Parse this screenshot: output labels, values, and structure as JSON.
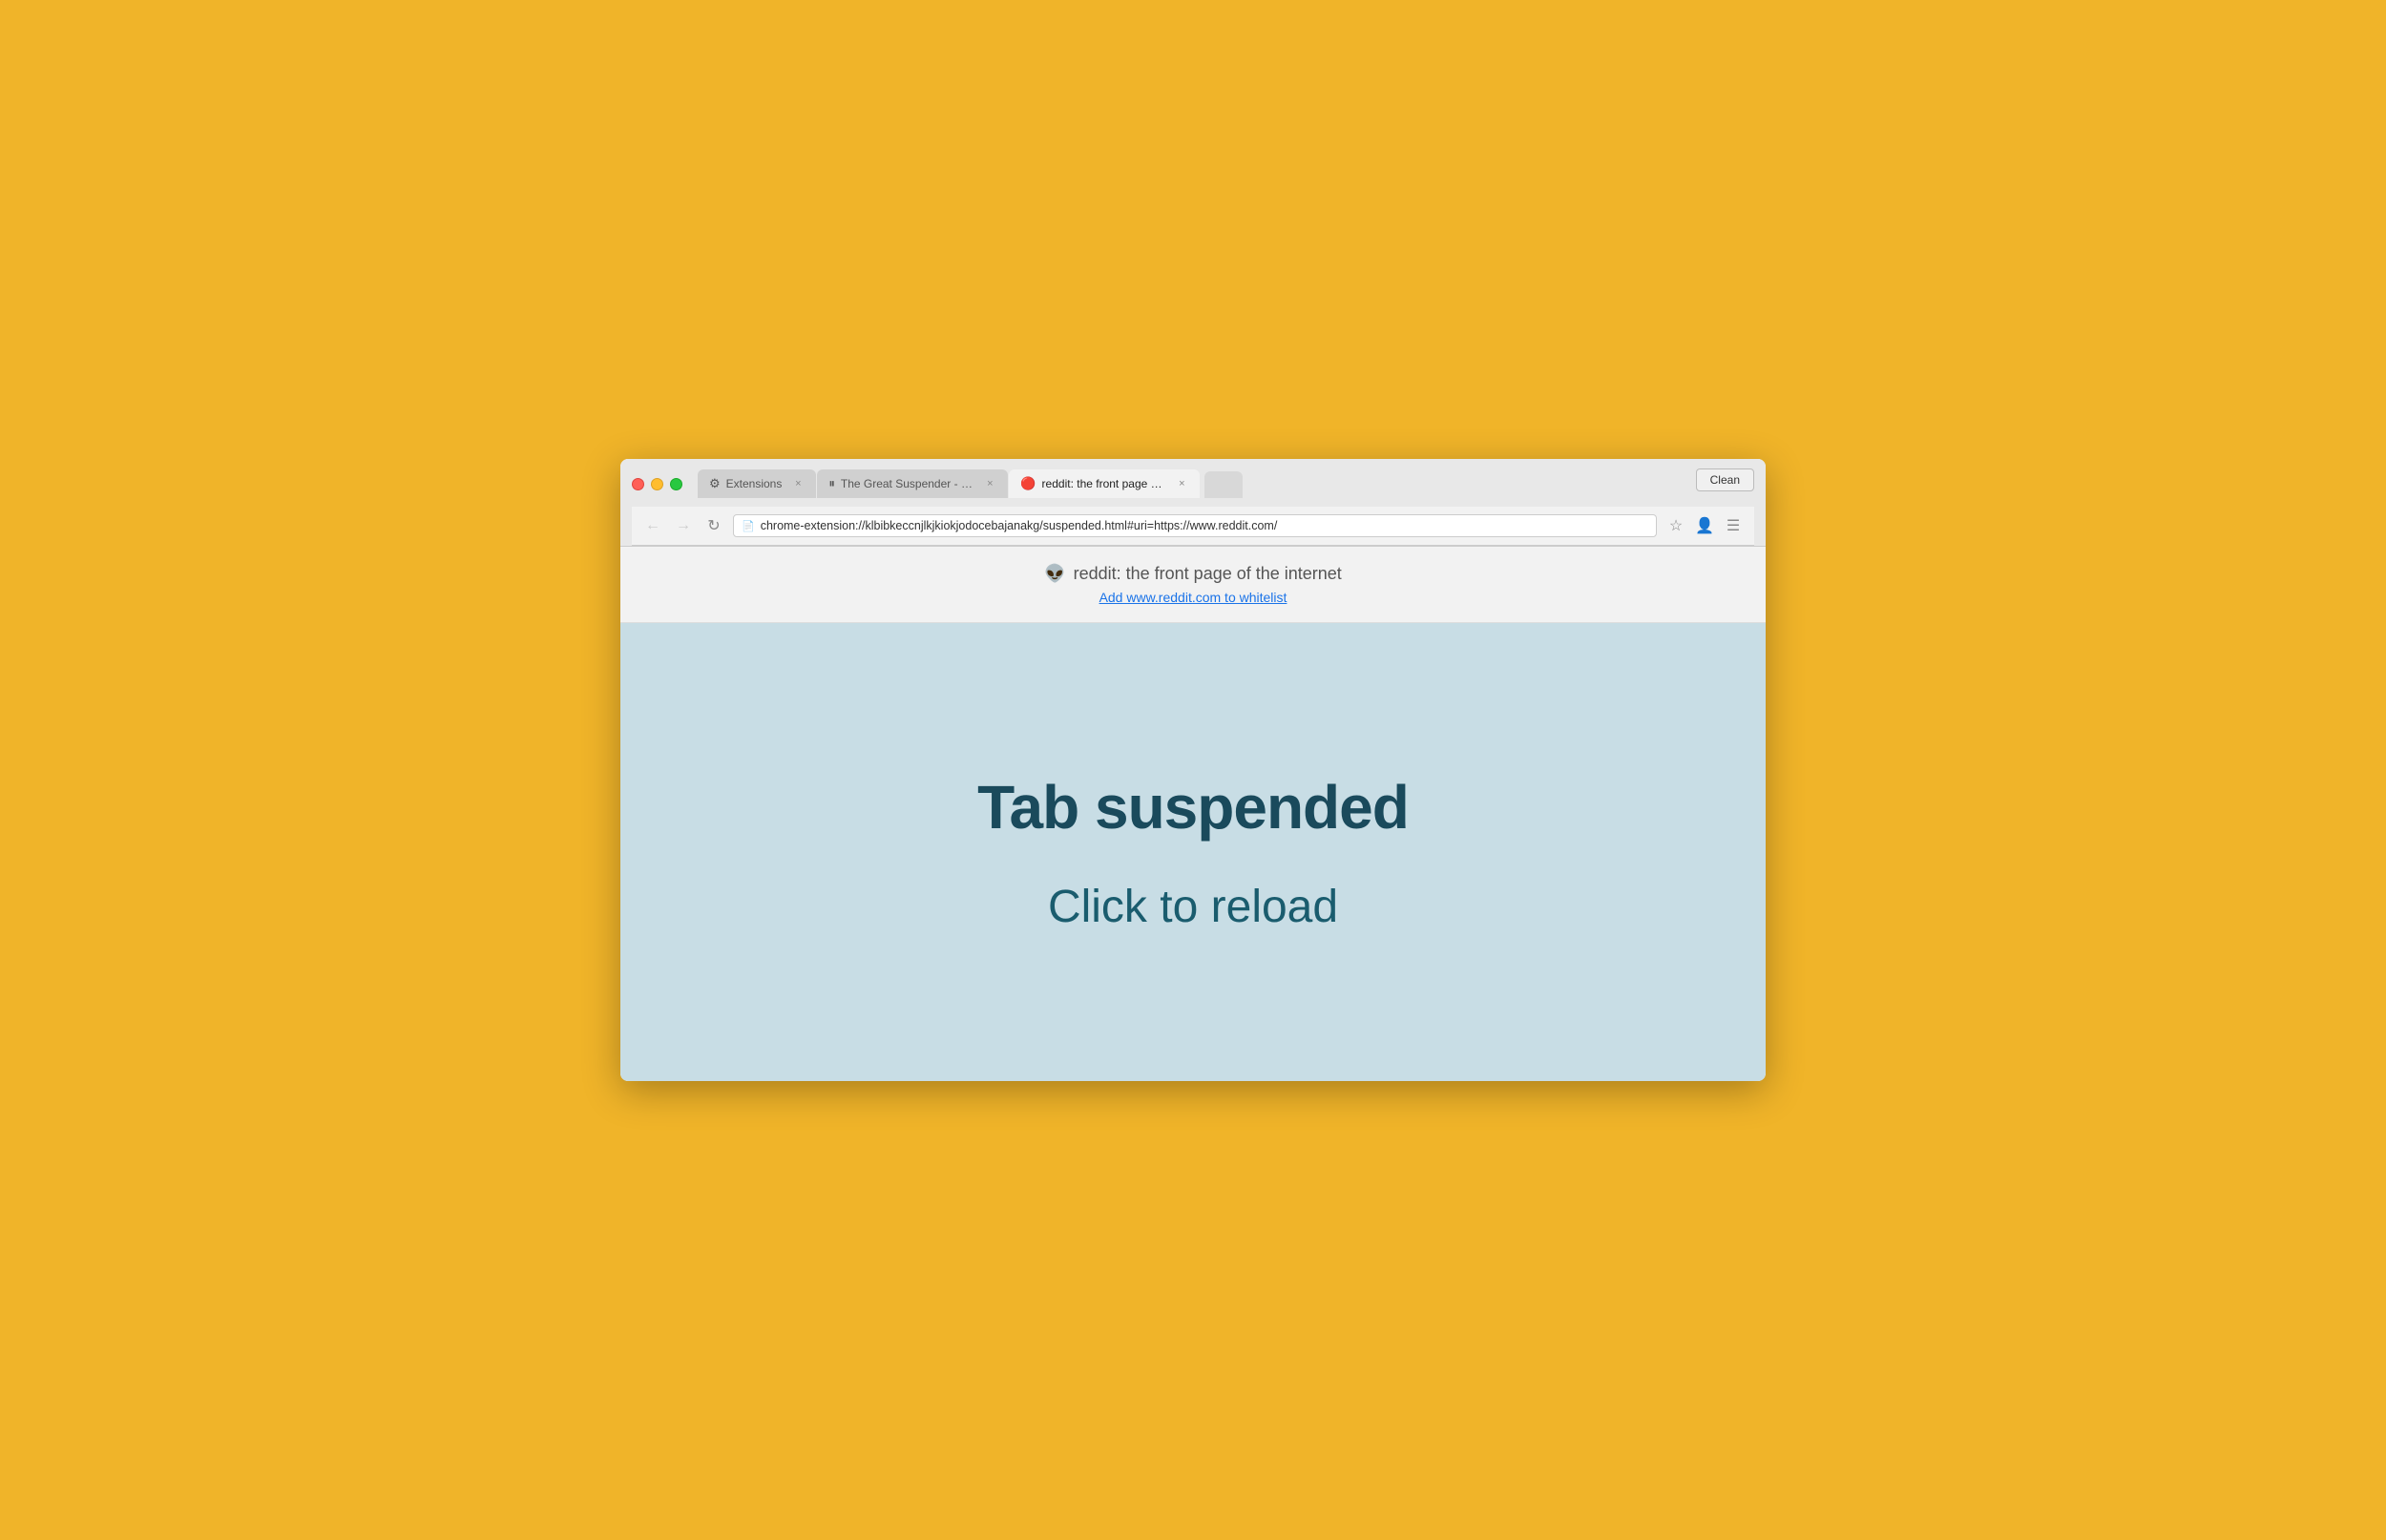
{
  "browser": {
    "clean_button": "Clean",
    "tabs": [
      {
        "id": "extensions",
        "icon": "⚙",
        "label": "Extensions",
        "active": false,
        "closeable": true
      },
      {
        "id": "great-suspender",
        "icon": "⏸",
        "label": "The Great Suspender - Ch…",
        "active": false,
        "closeable": true
      },
      {
        "id": "reddit",
        "icon": "🔴",
        "label": "reddit: the front page of th…",
        "active": true,
        "closeable": true
      }
    ],
    "url": "chrome-extension://klbibkeccnjlkjkiokjodocebajanakg/suspended.html#uri=https://www.reddit.com/",
    "back_disabled": true,
    "forward_disabled": true
  },
  "page": {
    "site_icon": "👽",
    "site_title": "reddit: the front page of the internet",
    "whitelist_link": "Add www.reddit.com to whitelist",
    "suspended_heading": "Tab suspended",
    "reload_prompt": "Click to reload"
  },
  "colors": {
    "background": "#F0B429",
    "page_bg": "#c8dde5",
    "text_dark": "#1a4a5c",
    "text_medium": "#1a5c6e"
  }
}
